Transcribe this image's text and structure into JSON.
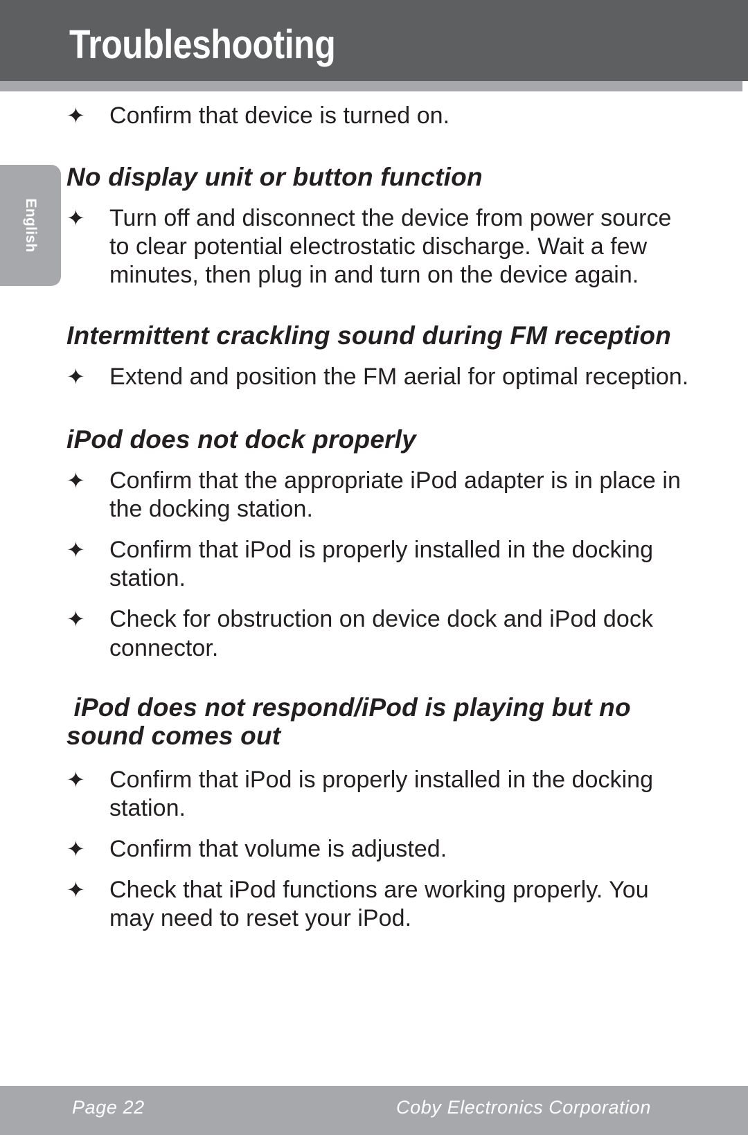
{
  "header": {
    "title": "Troubleshooting",
    "band_color": "#5e5f61",
    "rule_color": "#a6a8ab"
  },
  "side_tab": {
    "label": "English",
    "color": "#a6a8ab"
  },
  "bullet_glyph": "✦",
  "content": {
    "intro_bullets": [
      "Confirm that device is turned on."
    ],
    "sections": [
      {
        "heading": "No display unit or button function",
        "bullets": [
          "Turn off and disconnect the device from power source to clear potential electrostatic discharge. Wait a few minutes, then plug in and turn on the device again."
        ]
      },
      {
        "heading": "Intermittent crackling sound during FM reception",
        "bullets": [
          "Extend and position the FM aerial for optimal reception."
        ]
      },
      {
        "heading": "iPod does not dock properly",
        "bullets": [
          "Confirm that the appropriate iPod adapter is in place in the docking station.",
          "Confirm that iPod is properly installed in the docking station.",
          "Check for obstruction on device dock and iPod dock connector."
        ]
      },
      {
        "heading": " iPod does not respond/iPod is playing but no sound comes out",
        "bullets": [
          "Confirm that iPod is properly installed in the docking station.",
          "Confirm that volume is adjusted.",
          "Check that iPod functions are working properly. You may need to reset your iPod."
        ]
      }
    ]
  },
  "footer": {
    "page_label": "Page 22",
    "company": "Coby Electronics Corporation",
    "band_color": "#a6a8ab"
  }
}
